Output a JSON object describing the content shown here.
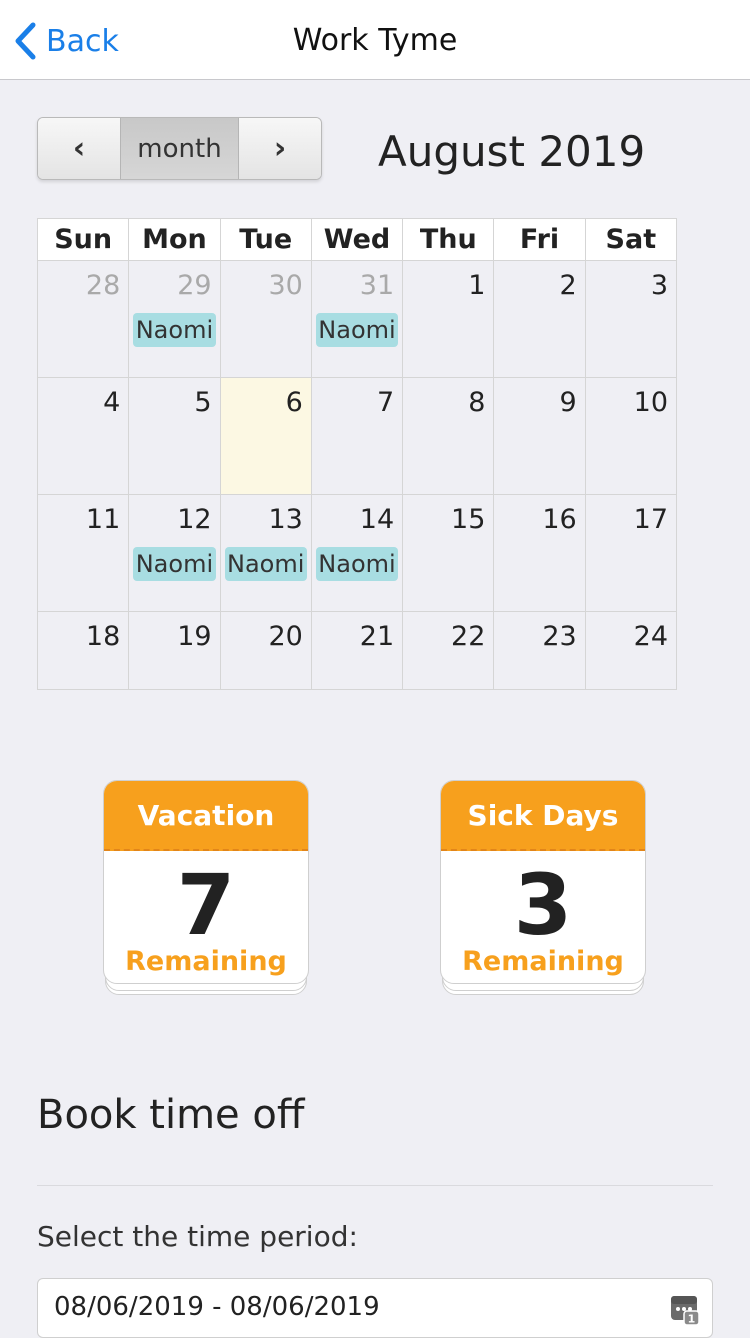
{
  "nav": {
    "back_label": "Back",
    "title": "Work Tyme"
  },
  "calendar": {
    "prev_label": "‹",
    "view_label": "month",
    "next_label": "›",
    "month_title": "August 2019",
    "weekdays": [
      "Sun",
      "Mon",
      "Tue",
      "Wed",
      "Thu",
      "Fri",
      "Sat"
    ],
    "weeks": [
      [
        {
          "day": "28",
          "other": true
        },
        {
          "day": "29",
          "other": true,
          "event": "Naomi"
        },
        {
          "day": "30",
          "other": true
        },
        {
          "day": "31",
          "other": true,
          "event": "Naomi"
        },
        {
          "day": "1"
        },
        {
          "day": "2"
        },
        {
          "day": "3"
        }
      ],
      [
        {
          "day": "4"
        },
        {
          "day": "5"
        },
        {
          "day": "6",
          "today": true
        },
        {
          "day": "7"
        },
        {
          "day": "8"
        },
        {
          "day": "9"
        },
        {
          "day": "10"
        }
      ],
      [
        {
          "day": "11"
        },
        {
          "day": "12",
          "event": "Naomi"
        },
        {
          "day": "13",
          "event": "Naomi"
        },
        {
          "day": "14",
          "event": "Naomi"
        },
        {
          "day": "15"
        },
        {
          "day": "16"
        },
        {
          "day": "17"
        }
      ],
      [
        {
          "day": "18"
        },
        {
          "day": "19"
        },
        {
          "day": "20"
        },
        {
          "day": "21"
        },
        {
          "day": "22"
        },
        {
          "day": "23"
        },
        {
          "day": "24"
        }
      ]
    ]
  },
  "cards": {
    "vacation": {
      "title": "Vacation",
      "count": "7",
      "sub": "Remaining"
    },
    "sick": {
      "title": "Sick Days",
      "count": "3",
      "sub": "Remaining"
    }
  },
  "booking": {
    "title": "Book time off",
    "period_label": "Select the time period:",
    "period_value": "08/06/2019 - 08/06/2019"
  },
  "colors": {
    "accent": "#1a7fe8",
    "card_header": "#f7a01d",
    "event_bg": "#a8dde2",
    "today_bg": "#fcf8e3"
  }
}
